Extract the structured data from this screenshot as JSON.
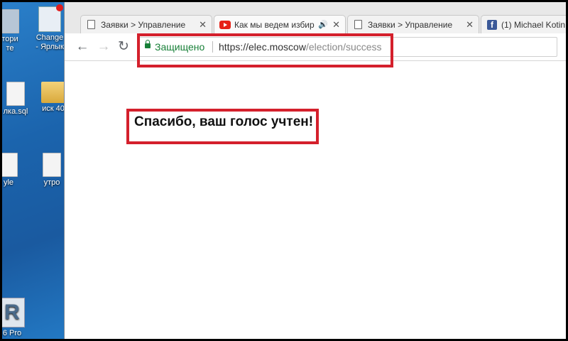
{
  "desktop": {
    "icons": [
      {
        "name": "desktop-icon-1",
        "label": "тори\nте"
      },
      {
        "name": "desktop-icon-2",
        "label": "Change\n- Ярлык"
      },
      {
        "name": "desktop-icon-3",
        "label": "лка.sql"
      },
      {
        "name": "desktop-icon-4",
        "label": "иск 40"
      },
      {
        "name": "desktop-icon-5",
        "label": "yle"
      },
      {
        "name": "desktop-icon-6",
        "label": "утро"
      },
      {
        "name": "desktop-icon-7",
        "label": "6 Pro"
      }
    ]
  },
  "tabs": [
    {
      "title": "Заявки > Управление",
      "icon": "page-icon",
      "close": "✕"
    },
    {
      "title": "Как мы ведем избир",
      "icon": "youtube-icon",
      "audio": "🔊",
      "close": "✕"
    },
    {
      "title": "Заявки > Управление",
      "icon": "page-icon",
      "close": "✕"
    },
    {
      "title": "(1) Michael Kotin",
      "icon": "facebook-icon",
      "fb_letter": "f"
    }
  ],
  "toolbar": {
    "back": "←",
    "forward": "→",
    "reload": "↻",
    "secure_label": "Защищено",
    "url_host": "https://elec.moscow",
    "url_path": "/election/success"
  },
  "page": {
    "message": "Спасибо, ваш голос учтен!"
  },
  "colors": {
    "highlight": "#d4202c",
    "secure": "#188038"
  }
}
